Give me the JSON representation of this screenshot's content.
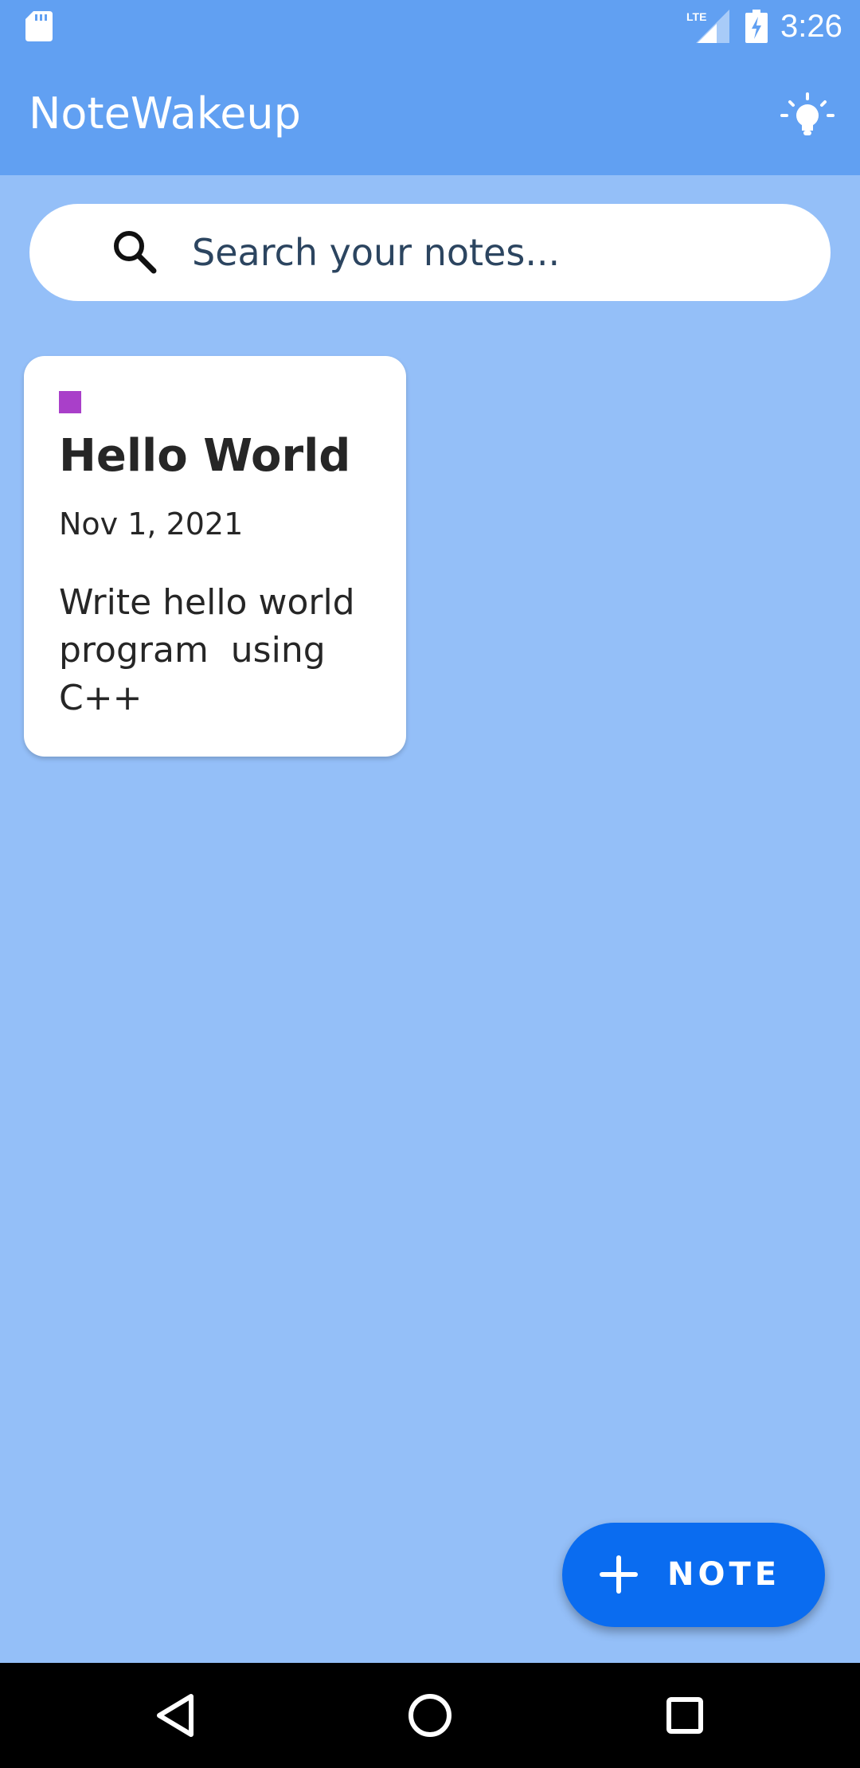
{
  "status_bar": {
    "time": "3:26",
    "network_label": "LTE",
    "icons": [
      "sd-card-icon",
      "lte-signal-icon",
      "battery-charging-icon"
    ]
  },
  "app_bar": {
    "title": "NoteWakeup",
    "action_icon": "lightbulb-icon"
  },
  "search": {
    "placeholder": "Search your notes...",
    "value": ""
  },
  "notes": [
    {
      "color": "#a93fc9",
      "title": "Hello World",
      "date": "Nov 1, 2021",
      "body": "Write hello world program  using C++"
    }
  ],
  "fab": {
    "label": "NOTE",
    "icon": "plus-icon"
  },
  "nav": {
    "icons": [
      "back-icon",
      "home-icon",
      "recents-icon"
    ]
  },
  "colors": {
    "app_bar": "#61a0f2",
    "background": "#94bff8",
    "fab": "#0a6cf0",
    "card": "#ffffff"
  }
}
